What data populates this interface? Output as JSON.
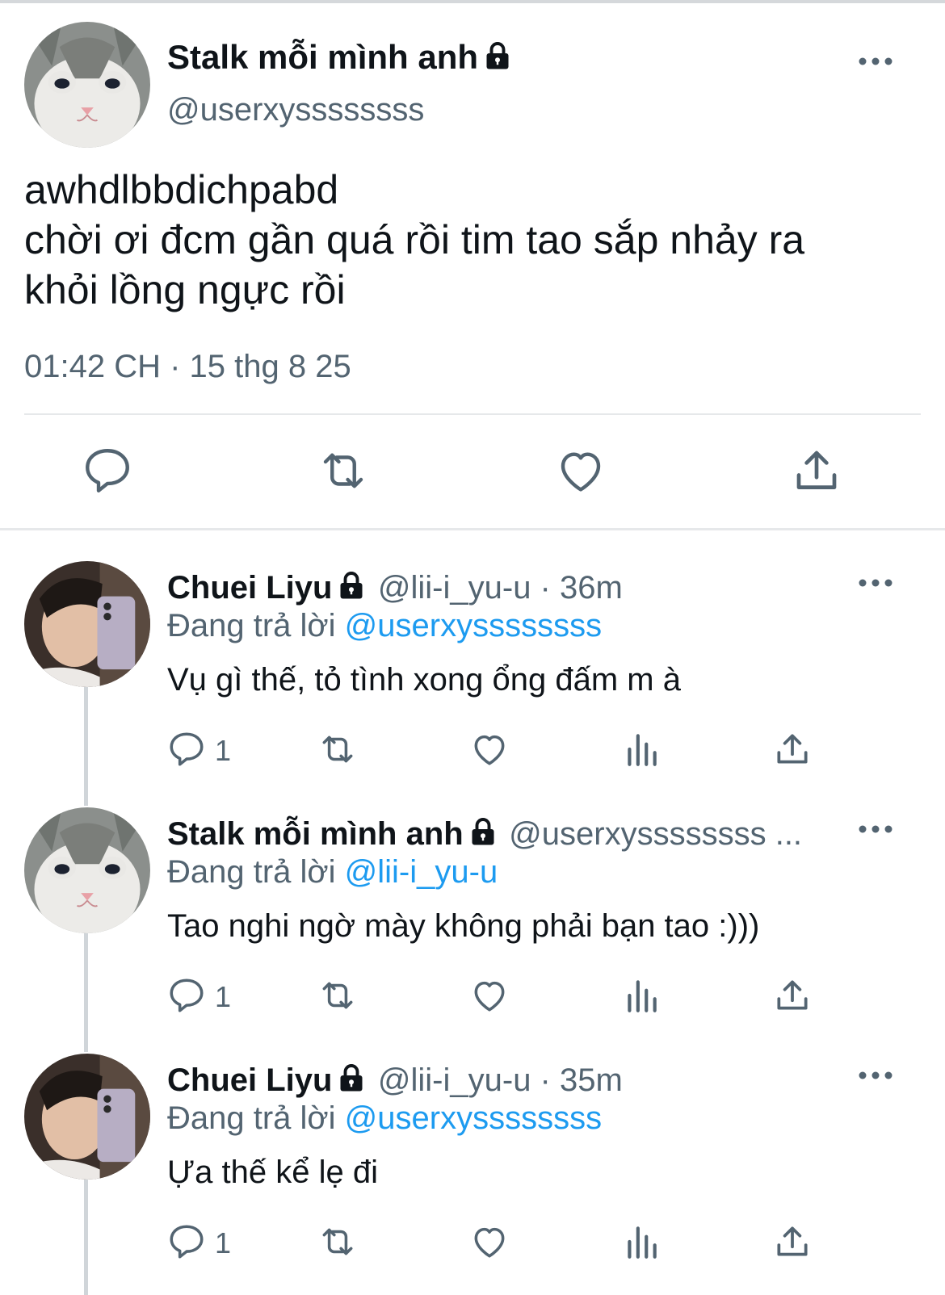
{
  "main_tweet": {
    "author_name": "Stalk mỗi mình anh",
    "handle": "@userxyssssssss",
    "text_lines": [
      "awhdlbbdichpabd",
      "chời ơi đcm gần quá rồi tim tao sắp nhảy ra",
      "khỏi lồng ngực rồi"
    ],
    "timestamp": "01:42 CH · 15 thg 8 25"
  },
  "icons": {
    "reply": "reply-bubble-icon",
    "retweet": "retweet-icon",
    "like": "heart-icon",
    "share": "share-upload-icon",
    "views": "analytics-bars-icon",
    "more": "more-dots-icon",
    "lock": "lock-icon"
  },
  "colors": {
    "link": "#1d9bf0",
    "secondary": "#536471",
    "text": "#0f1419"
  },
  "replies": [
    {
      "author_name": "Chuei Liyu",
      "handle": "@lii-i_yu-u · 36m",
      "replying_prefix": "Đang trả lời ",
      "replying_to": "@userxyssssssss",
      "text": "Vụ gì thế, tỏ tình xong ổng đấm m à",
      "reply_count": "1"
    },
    {
      "author_name": "Stalk mỗi mình anh",
      "handle": "@userxyssssssss ...",
      "replying_prefix": "Đang trả lời ",
      "replying_to": "@lii-i_yu-u",
      "text": "Tao nghi ngờ mày không phải bạn tao :)))",
      "reply_count": "1"
    },
    {
      "author_name": "Chuei Liyu",
      "handle": "@lii-i_yu-u · 35m",
      "replying_prefix": "Đang trả lời ",
      "replying_to": "@userxyssssssss",
      "text": "Ựa thế kể lẹ đi",
      "reply_count": "1"
    }
  ]
}
